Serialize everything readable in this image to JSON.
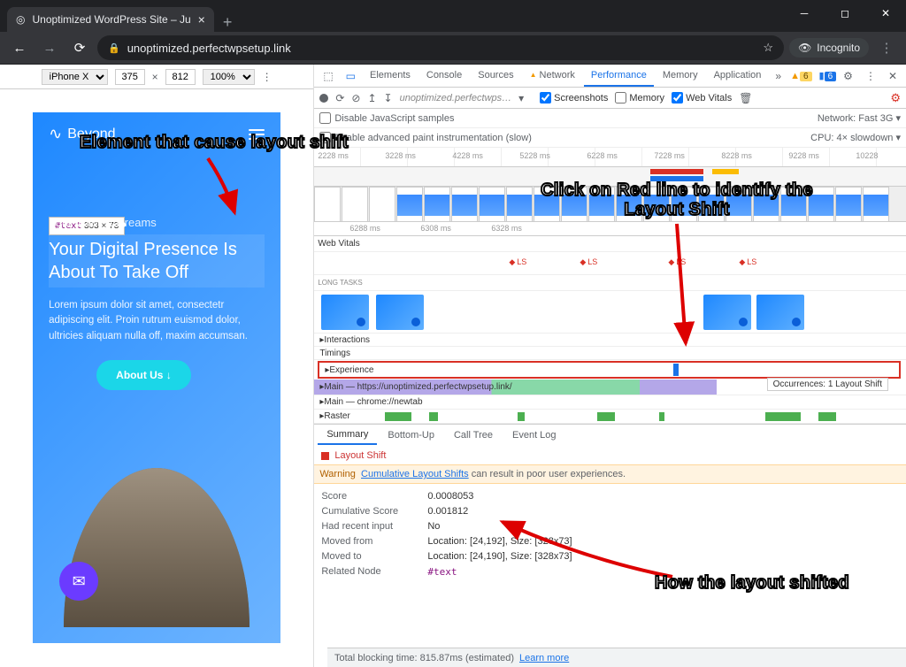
{
  "browser": {
    "tab_title": "Unoptimized WordPress Site – Ju",
    "url": "unoptimized.perfectwpsetup.link",
    "incognito": "Incognito"
  },
  "device_toolbar": {
    "device": "iPhone X",
    "width": "375",
    "height": "812",
    "zoom": "100%"
  },
  "phone": {
    "brand": "Beyond",
    "tooltip_tag": "#text",
    "tooltip_dims": "303 × 73",
    "hero_small": "Your Wildest Dreams",
    "hero_big": "Your Digital Presence Is About To Take Off",
    "hero_body": "Lorem ipsum dolor sit amet, consectetr adipiscing elit. Proin rutrum euismod dolor, ultricies aliquam nulla off, maxim accumsan.",
    "cta": "About Us  ↓"
  },
  "devtools": {
    "tabs": [
      "Elements",
      "Console",
      "Sources",
      "Network",
      "Performance",
      "Memory",
      "Application"
    ],
    "active_tab": "Performance",
    "warn_count": "6",
    "info_count": "6",
    "toolbar_url": "unoptimized.perfectwps…",
    "screenshots": "Screenshots",
    "memory": "Memory",
    "web_vitals": "Web Vitals",
    "disable_js": "Disable JavaScript samples",
    "paint_instr": "Enable advanced paint instrumentation (slow)",
    "network_label": "Network:",
    "network_val": "Fast 3G",
    "cpu_label": "CPU:",
    "cpu_val": "4× slowdown",
    "overview_ticks": [
      "2228 ms",
      "3228 ms",
      "4228 ms",
      "5228 ms",
      "6228 ms",
      "7228 ms",
      "8228 ms",
      "9228 ms",
      "10228"
    ],
    "ruler2_ticks": [
      "6288 ms",
      "6308 ms",
      "6328 ms"
    ],
    "web_vitals_label": "Web Vitals",
    "ls_label": "LS",
    "long_tasks": "LONG TASKS",
    "interactions": "Interactions",
    "timings": "Timings",
    "experience": "Experience",
    "main_label": "Main — https://unoptimized.perfectwpsetup.link/",
    "occurrences": "Occurrences: 1   Layout Shift",
    "chrome_label": "Main — chrome://newtab",
    "raster": "Raster",
    "sum_tabs": [
      "Summary",
      "Bottom-Up",
      "Call Tree",
      "Event Log"
    ],
    "detail_title": "Layout Shift",
    "warning_prefix": "Warning",
    "warning_link": "Cumulative Layout Shifts",
    "warning_suffix": " can result in poor user experiences.",
    "kv": {
      "score_k": "Score",
      "score_v": "0.0008053",
      "cum_k": "Cumulative Score",
      "cum_v": "0.001812",
      "had_k": "Had recent input",
      "had_v": "No",
      "from_k": "Moved from",
      "from_v": "Location: [24,192], Size: [328x73]",
      "to_k": "Moved to",
      "to_v": "Location: [24,190], Size: [328x73]",
      "node_k": "Related Node",
      "node_v": "#text"
    },
    "footer_prefix": "Total blocking time: 815.87ms (estimated)",
    "footer_link": "Learn more"
  },
  "annotations": {
    "a1": "Element that cause layout shift",
    "a2": "Click on Red line to identify the Layout Shift",
    "a3": "How the layout shifted"
  }
}
